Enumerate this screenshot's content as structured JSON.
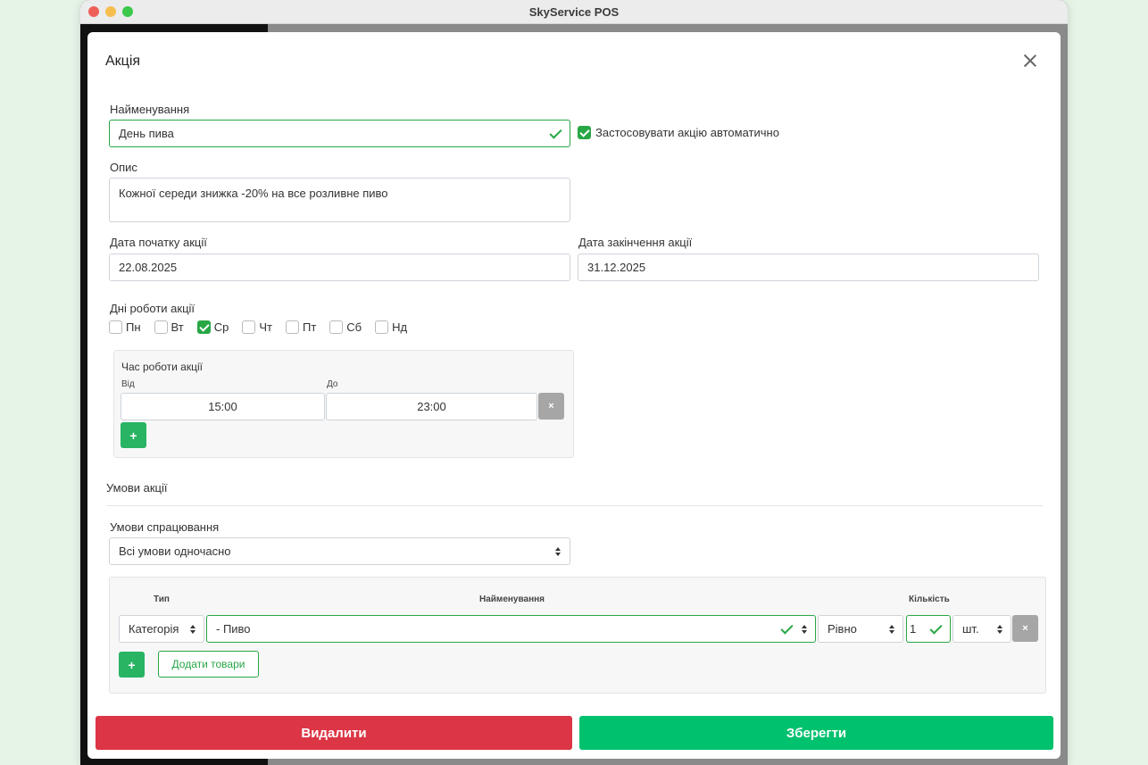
{
  "window": {
    "title": "SkyService POS"
  },
  "modal": {
    "title": "Акція",
    "name_label": "Найменування",
    "name_value": "День пива",
    "auto_apply_label": "Застосовувати акцію автоматично",
    "auto_apply_checked": true,
    "description_label": "Опис",
    "description_value": "Кожної середи знижка -20% на все розливне пиво",
    "start_date_label": "Дата початку акції",
    "start_date_value": "22.08.2025",
    "end_date_label": "Дата закінчення акції",
    "end_date_value": "31.12.2025",
    "days_label": "Дні роботи акції",
    "days": [
      {
        "label": "Пн",
        "checked": false
      },
      {
        "label": "Вт",
        "checked": false
      },
      {
        "label": "Ср",
        "checked": true
      },
      {
        "label": "Чт",
        "checked": false
      },
      {
        "label": "Пт",
        "checked": false
      },
      {
        "label": "Сб",
        "checked": false
      },
      {
        "label": "Нд",
        "checked": false
      }
    ],
    "time": {
      "title": "Час роботи акції",
      "from_label": "Від",
      "to_label": "До",
      "from_value": "15:00",
      "to_value": "23:00",
      "remove_label": "×",
      "add_label": "+"
    },
    "conditions_title": "Умови акції",
    "trigger_label": "Умови спрацювання",
    "trigger_value": "Всі умови одночасно",
    "conditions_table": {
      "col_type": "Тип",
      "col_name": "Найменування",
      "col_qty": "Кількість",
      "type_value": "Категорія",
      "name_value": "- Пиво",
      "compare_value": "Рівно",
      "qty_value": "1",
      "unit_value": "шт.",
      "remove_label": "×",
      "add_label": "+",
      "add_products_label": "Додати товари"
    },
    "delete_label": "Видалити",
    "save_label": "Зберегти"
  },
  "colors": {
    "accent_green": "#28a745",
    "save_green": "#00c16e",
    "delete_red": "#dc3545"
  }
}
